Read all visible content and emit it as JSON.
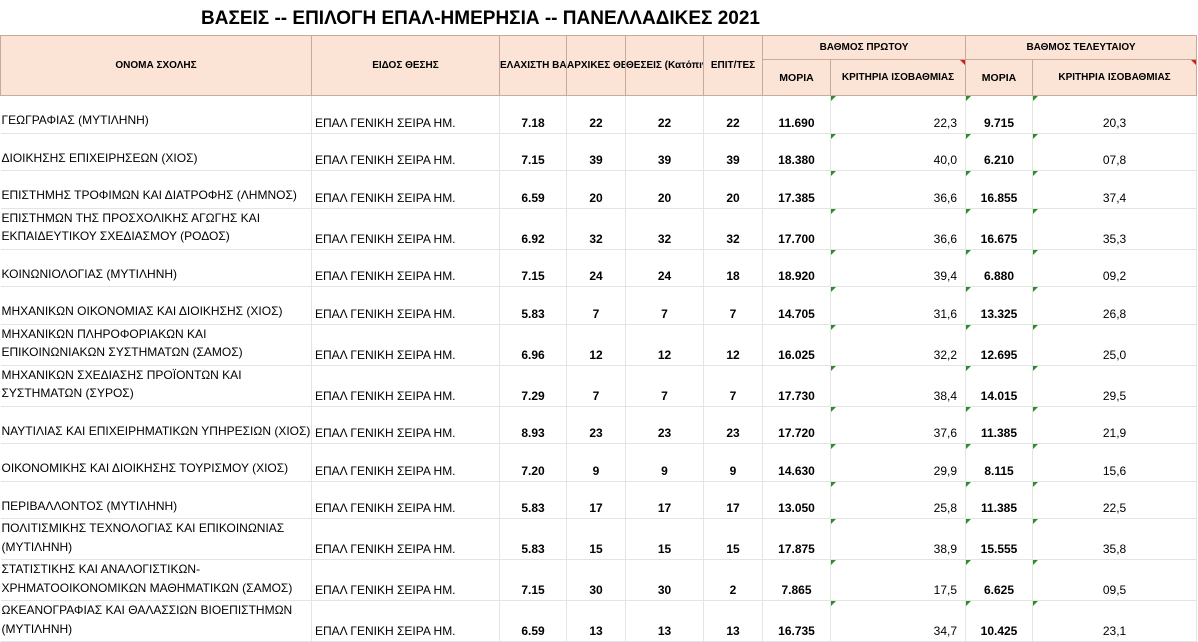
{
  "title": "ΒΑΣΕΙΣ -- ΕΠΙΛΟΓΗ ΕΠΑΛ-ΗΜΕΡΗΣΙΑ -- ΠΑΝΕΛΛΑΔΙΚΕΣ 2021",
  "headers": {
    "name": "ΟΝΟΜΑ ΣΧΟΛΗΣ",
    "type": "ΕΙΔΟΣ ΘΕΣΗΣ",
    "min_base": "ΕΛΑΧΙΣΤΗ ΒΑΣΗ ΕΙΣΑΓΩΓΗΣ",
    "initial_places": "ΑΡΧΙΚΕΣ ΘΕΣΕΙΣ",
    "places": "ΘΕΣΕΙΣ (Κατόπιν Μεταφοράς)",
    "admitted": "ΕΠΙΤ/ΤΕΣ",
    "first_group": "ΒΑΘΜΟΣ ΠΡΩΤΟΥ",
    "last_group": "ΒΑΘΜΟΣ ΤΕΛΕΥΤΑΙΟΥ",
    "points": "ΜΟΡΙΑ",
    "criteria": "ΚΡΙΤΗΡΙΑ ΙΣΟΒΑΘΜΙΑΣ"
  },
  "rows": [
    {
      "name": "ΓΕΩΓΡΑΦΙΑΣ (ΜΥΤΙΛΗΝΗ)",
      "type": "ΕΠΑΛ ΓΕΝΙΚΗ ΣΕΙΡΑ ΗΜ.",
      "min_base": "7.18",
      "initial": "22",
      "places": "22",
      "admitted": "22",
      "first_points": "11.690",
      "first_criteria": "22,3",
      "last_points": "9.715",
      "last_criteria": "20,3"
    },
    {
      "name": "ΔΙΟΙΚΗΣΗΣ ΕΠΙΧΕΙΡΗΣΕΩΝ (ΧΙΟΣ)",
      "type": "ΕΠΑΛ ΓΕΝΙΚΗ ΣΕΙΡΑ ΗΜ.",
      "min_base": "7.15",
      "initial": "39",
      "places": "39",
      "admitted": "39",
      "first_points": "18.380",
      "first_criteria": "40,0",
      "last_points": "6.210",
      "last_criteria": "07,8"
    },
    {
      "name": "ΕΠΙΣΤΗΜΗΣ ΤΡΟΦΙΜΩΝ ΚΑΙ ΔΙΑΤΡΟΦΗΣ (ΛΗΜΝΟΣ)",
      "type": "ΕΠΑΛ ΓΕΝΙΚΗ ΣΕΙΡΑ ΗΜ.",
      "min_base": "6.59",
      "initial": "20",
      "places": "20",
      "admitted": "20",
      "first_points": "17.385",
      "first_criteria": "36,6",
      "last_points": "16.855",
      "last_criteria": "37,4"
    },
    {
      "name": "ΕΠΙΣΤΗΜΩΝ ΤΗΣ ΠΡΟΣΧΟΛΙΚΗΣ ΑΓΩΓΗΣ ΚΑΙ ΕΚΠΑΙΔΕΥΤΙΚΟΥ ΣΧΕΔΙΑΣΜΟΥ (ΡΟΔΟΣ)",
      "type": "ΕΠΑΛ ΓΕΝΙΚΗ ΣΕΙΡΑ ΗΜ.",
      "min_base": "6.92",
      "initial": "32",
      "places": "32",
      "admitted": "32",
      "first_points": "17.700",
      "first_criteria": "36,6",
      "last_points": "16.675",
      "last_criteria": "35,3"
    },
    {
      "name": "ΚΟΙΝΩΝΙΟΛΟΓΙΑΣ (ΜΥΤΙΛΗΝΗ)",
      "type": "ΕΠΑΛ ΓΕΝΙΚΗ ΣΕΙΡΑ ΗΜ.",
      "min_base": "7.15",
      "initial": "24",
      "places": "24",
      "admitted": "18",
      "first_points": "18.920",
      "first_criteria": "39,4",
      "last_points": "6.880",
      "last_criteria": "09,2"
    },
    {
      "name": "ΜΗΧΑΝΙΚΩΝ ΟΙΚΟΝΟΜΙΑΣ ΚΑΙ ΔΙΟΙΚΗΣΗΣ (ΧΙΟΣ)",
      "type": "ΕΠΑΛ ΓΕΝΙΚΗ ΣΕΙΡΑ ΗΜ.",
      "min_base": "5.83",
      "initial": "7",
      "places": "7",
      "admitted": "7",
      "first_points": "14.705",
      "first_criteria": "31,6",
      "last_points": "13.325",
      "last_criteria": "26,8"
    },
    {
      "name": "ΜΗΧΑΝΙΚΩΝ ΠΛΗΡΟΦΟΡΙΑΚΩΝ ΚΑΙ ΕΠΙΚΟΙΝΩΝΙΑΚΩΝ ΣΥΣΤΗΜΑΤΩΝ (ΣΑΜΟΣ)",
      "type": "ΕΠΑΛ ΓΕΝΙΚΗ ΣΕΙΡΑ ΗΜ.",
      "min_base": "6.96",
      "initial": "12",
      "places": "12",
      "admitted": "12",
      "first_points": "16.025",
      "first_criteria": "32,2",
      "last_points": "12.695",
      "last_criteria": "25,0"
    },
    {
      "name": "ΜΗΧΑΝΙΚΩΝ ΣΧΕΔΙΑΣΗΣ ΠΡΟΪΟΝΤΩΝ ΚΑΙ ΣΥΣΤΗΜΑΤΩΝ (ΣΥΡΟΣ)",
      "type": "ΕΠΑΛ ΓΕΝΙΚΗ ΣΕΙΡΑ ΗΜ.",
      "min_base": "7.29",
      "initial": "7",
      "places": "7",
      "admitted": "7",
      "first_points": "17.730",
      "first_criteria": "38,4",
      "last_points": "14.015",
      "last_criteria": "29,5"
    },
    {
      "name": "ΝΑΥΤΙΛΙΑΣ ΚΑΙ ΕΠΙΧΕΙΡΗΜΑΤΙΚΩΝ ΥΠΗΡΕΣΙΩΝ (ΧΙΟΣ)",
      "type": "ΕΠΑΛ ΓΕΝΙΚΗ ΣΕΙΡΑ ΗΜ.",
      "min_base": "8.93",
      "initial": "23",
      "places": "23",
      "admitted": "23",
      "first_points": "17.720",
      "first_criteria": "37,6",
      "last_points": "11.385",
      "last_criteria": "21,9"
    },
    {
      "name": "ΟΙΚΟΝΟΜΙΚΗΣ ΚΑΙ ΔΙΟΙΚΗΣΗΣ ΤΟΥΡΙΣΜΟΥ (ΧΙΟΣ)",
      "type": "ΕΠΑΛ ΓΕΝΙΚΗ ΣΕΙΡΑ ΗΜ.",
      "min_base": "7.20",
      "initial": "9",
      "places": "9",
      "admitted": "9",
      "first_points": "14.630",
      "first_criteria": "29,9",
      "last_points": "8.115",
      "last_criteria": "15,6"
    },
    {
      "name": "ΠΕΡΙΒΑΛΛΟΝΤΟΣ (ΜΥΤΙΛΗΝΗ)",
      "type": "ΕΠΑΛ ΓΕΝΙΚΗ ΣΕΙΡΑ ΗΜ.",
      "min_base": "5.83",
      "initial": "17",
      "places": "17",
      "admitted": "17",
      "first_points": "13.050",
      "first_criteria": "25,8",
      "last_points": "11.385",
      "last_criteria": "22,5"
    },
    {
      "name": "ΠΟΛΙΤΙΣΜΙΚΗΣ ΤΕΧΝΟΛΟΓΙΑΣ ΚΑΙ ΕΠΙΚΟΙΝΩΝΙΑΣ (ΜΥΤΙΛΗΝΗ)",
      "type": "ΕΠΑΛ ΓΕΝΙΚΗ ΣΕΙΡΑ ΗΜ.",
      "min_base": "5.83",
      "initial": "15",
      "places": "15",
      "admitted": "15",
      "first_points": "17.875",
      "first_criteria": "38,9",
      "last_points": "15.555",
      "last_criteria": "35,8"
    },
    {
      "name": "ΣΤΑΤΙΣΤΙΚΗΣ ΚΑΙ ΑΝΑΛΟΓΙΣΤΙΚΩΝ-ΧΡΗΜΑΤΟΟΙΚΟΝΟΜΙΚΩΝ ΜΑΘΗΜΑΤΙΚΩΝ (ΣΑΜΟΣ)",
      "type": "ΕΠΑΛ ΓΕΝΙΚΗ ΣΕΙΡΑ ΗΜ.",
      "min_base": "7.15",
      "initial": "30",
      "places": "30",
      "admitted": "2",
      "first_points": "7.865",
      "first_criteria": "17,5",
      "last_points": "6.625",
      "last_criteria": "09,5"
    },
    {
      "name": "ΩΚΕΑΝΟΓΡΑΦΙΑΣ ΚΑΙ ΘΑΛΑΣΣΙΩΝ ΒΙΟΕΠΙΣΤΗΜΩΝ (ΜΥΤΙΛΗΝΗ)",
      "type": "ΕΠΑΛ ΓΕΝΙΚΗ ΣΕΙΡΑ ΗΜ.",
      "min_base": "6.59",
      "initial": "13",
      "places": "13",
      "admitted": "13",
      "first_points": "16.735",
      "first_criteria": "34,7",
      "last_points": "10.425",
      "last_criteria": "23,1"
    }
  ]
}
